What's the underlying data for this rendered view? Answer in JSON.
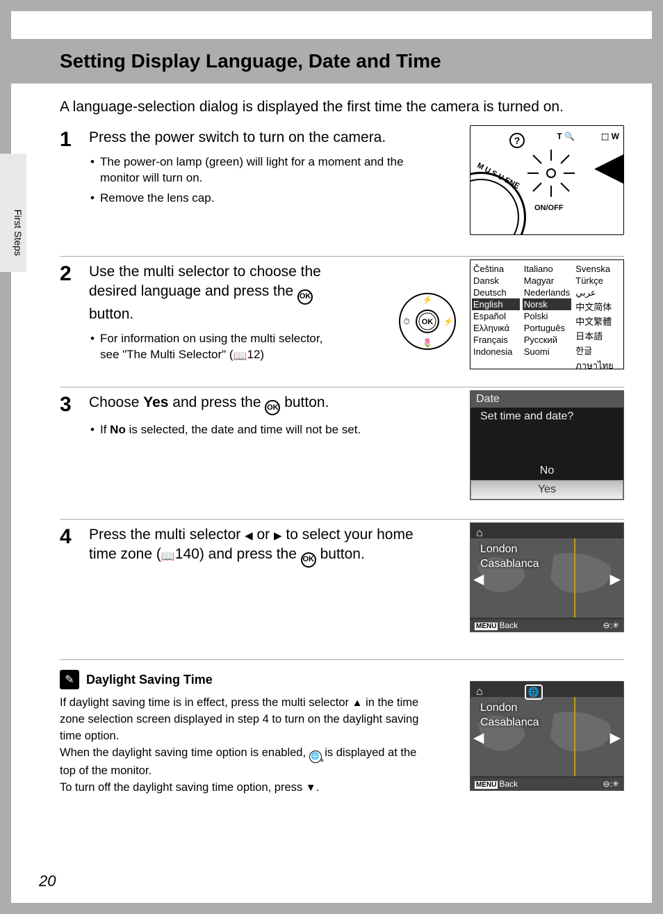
{
  "header": {
    "title": "Setting Display Language, Date and Time"
  },
  "sidebar_tab": "First Steps",
  "page_number": "20",
  "intro": "A language-selection dialog is displayed the first time the camera is turned on.",
  "steps": {
    "s1": {
      "num": "1",
      "head": "Press the power switch to turn on the camera.",
      "b1": "The power-on lamp (green) will light for a moment and the monitor will turn on.",
      "b2": "Remove the lens cap."
    },
    "s2": {
      "num": "2",
      "head_a": "Use the multi selector to choose the desired language and press the ",
      "head_b": " button.",
      "b1_a": "For information on using the multi selector, see \"The Multi Selector\" (",
      "b1_b": "12)"
    },
    "s3": {
      "num": "3",
      "head_a": "Choose ",
      "head_bold": "Yes",
      "head_b": " and press the ",
      "head_c": " button.",
      "b1_a": "If ",
      "b1_bold": "No",
      "b1_b": " is selected, the date and time will not be set."
    },
    "s4": {
      "num": "4",
      "head_a": "Press the multi selector ",
      "head_b": " or ",
      "head_c": " to select your home time zone (",
      "head_d": "140) and press the ",
      "head_e": " button."
    }
  },
  "cam_illus": {
    "t_label": "T",
    "w_label": "W",
    "onoff": "ON/OFF",
    "q": "?",
    "dial_letters": "M\nU\nS\nU\nENE"
  },
  "selector_labels": {
    "ok": "OK"
  },
  "lang_panel": {
    "col1": [
      "Čeština",
      "Dansk",
      "Deutsch",
      "English",
      "Español",
      "Ελληνικά",
      "Français",
      "Indonesia"
    ],
    "col2": [
      "Italiano",
      "Magyar",
      "Nederlands",
      "Norsk",
      "Polski",
      "Português",
      "Русский",
      "Suomi"
    ],
    "col3": [
      "Svenska",
      "Türkçe",
      "عربي",
      "中文简体",
      "中文繁體",
      "日本語",
      "한글",
      "ภาษาไทย"
    ],
    "selected": "English",
    "selected_col2": "Norsk"
  },
  "date_panel": {
    "title": "Date",
    "prompt": "Set time and date?",
    "opt_no": "No",
    "opt_yes": "Yes"
  },
  "tz_panel": {
    "city1": "London",
    "city2": "Casablanca",
    "back": "Back",
    "menu": "MENU"
  },
  "dst": {
    "title": "Daylight Saving Time",
    "p1_a": "If daylight saving time is in effect, press the multi selector ",
    "p1_b": " in the time zone selection screen displayed in step 4 to turn on the daylight saving time option.",
    "p2_a": "When the daylight saving time option is enabled, ",
    "p2_b": " is displayed at the top of the monitor.",
    "p3_a": "To turn off the daylight saving time option, press ",
    "p3_b": "."
  }
}
